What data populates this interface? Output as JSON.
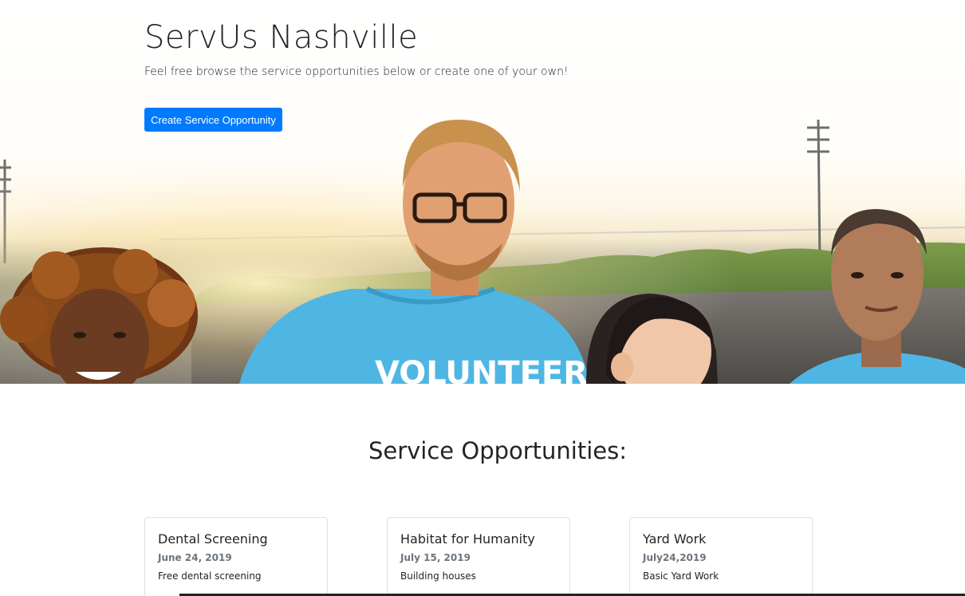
{
  "hero": {
    "title": "ServUs Nashville",
    "lead": "Feel free browse the service opportunities below or create one of your own!",
    "create_button_label": "Create Service Opportunity",
    "banner_shirt_text": "VOLUNTEER"
  },
  "section": {
    "title": "Service Opportunities:"
  },
  "cards": [
    {
      "title": "Dental Screening",
      "date": "June 24, 2019",
      "description": "Free dental screening"
    },
    {
      "title": "Habitat for Humanity",
      "date": "July 15, 2019",
      "description": "Building houses"
    },
    {
      "title": "Yard Work",
      "date": "July24,2019",
      "description": "Basic Yard Work"
    }
  ],
  "colors": {
    "primary": "#007bff",
    "volunteer_shirt": "#4fb6e3"
  }
}
